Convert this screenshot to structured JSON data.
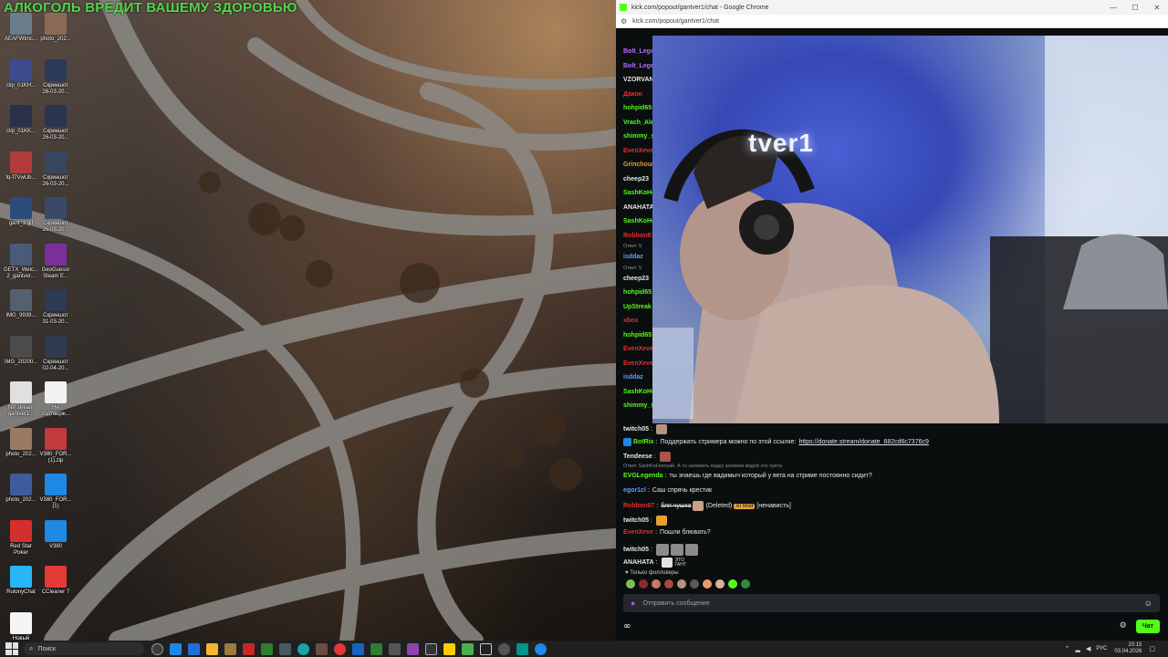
{
  "desktop": {
    "banner": "АЛКОГОЛЬ ВРЕДИТ ВАШЕМУ ЗДОРОВЬЮ",
    "icons": [
      {
        "label": "AEAFWtmc...",
        "color": "#6b7d8c"
      },
      {
        "label": "photo_202...",
        "color": "#8a6a55"
      },
      {
        "label": "clip_01KH...",
        "color": "#3e4b8e"
      },
      {
        "label": "Скриншот\n26-03-20...",
        "color": "#2c3a5a"
      },
      {
        "label": "clip_01KK...",
        "color": "#2b2f48"
      },
      {
        "label": "Скриншот\n26-03-20...",
        "color": "#2a3550"
      },
      {
        "label": "fq-f7VwUb...",
        "color": "#b23b3b"
      },
      {
        "label": "Скриншот\n26-03-20...",
        "color": "#384560"
      },
      {
        "label": "gant_3.gif",
        "color": "#2c4a7a"
      },
      {
        "label": "Скриншот\n26-03-20...",
        "color": "#3a4a66"
      },
      {
        "label": "GETX_Welc...\n2_gantver...",
        "color": "#4a5a78"
      },
      {
        "label": "GeoGuessr\nSteam E...",
        "color": "#7a2f9a"
      },
      {
        "label": "IMG_9939...",
        "color": "#55606e"
      },
      {
        "label": "Скриншот\n31-03-20...",
        "color": "#2f3b55"
      },
      {
        "label": "IMG_20200...",
        "color": "#4b4b4b"
      },
      {
        "label": "Скриншот\n02-04-20...",
        "color": "#303a50"
      },
      {
        "label": "NP stream\ngantver1...",
        "color": "#e0e0e0"
      },
      {
        "label": "Не\nподтверж...",
        "color": "#f2f2f2"
      },
      {
        "label": "photo_202...",
        "color": "#9a7a60"
      },
      {
        "label": "V380_FOR...\n(1).zip",
        "color": "#c23a3a"
      },
      {
        "label": "photo_202...",
        "color": "#3d5d9a"
      },
      {
        "label": "V380_FOR...\n(1)",
        "color": "#1e88e5"
      },
      {
        "label": "Red Star\nPoker",
        "color": "#d32f2f"
      },
      {
        "label": "V380",
        "color": "#1e88e5"
      },
      {
        "label": "RutonyChat",
        "color": "#29b6f6"
      },
      {
        "label": "CCleaner 7",
        "color": "#e53935"
      },
      {
        "label": "Новый\nтекстовый ...",
        "color": "#f5f5f5"
      }
    ]
  },
  "browser": {
    "title": "kick.com/popout/gantver1/chat - Google Chrome",
    "url": "kick.com/popout/gantver1/chat",
    "controls": {
      "minimize": "—",
      "maximize": "☐",
      "close": "✕"
    },
    "video_wall_text": "tver1"
  },
  "chat": {
    "side_users": [
      {
        "name": "Bolt_Lege",
        "color": "#b56cff"
      },
      {
        "name": "Bolt_Lege",
        "color": "#b56cff"
      },
      {
        "name": "VZORVAN",
        "color": "#e6e6e6"
      },
      {
        "name": "Дакон",
        "color": "#e03030"
      },
      {
        "name": "hohpid65",
        "color": "#53fc18"
      },
      {
        "name": "Vrach_Ale",
        "color": "#53fc18"
      },
      {
        "name": "shimmy_s",
        "color": "#53fc18"
      },
      {
        "name": "EvenXeve",
        "color": "#e03030"
      },
      {
        "name": "Grinchoun",
        "color": "#e0a030"
      },
      {
        "name": "cheep23",
        "color": "#e6e6e6"
      },
      {
        "name": "SashKoHo",
        "color": "#53fc18"
      },
      {
        "name": "ANAHATA",
        "color": "#e6e6e6"
      },
      {
        "name": "SashKoHo",
        "color": "#53fc18"
      },
      {
        "name": "Robbon87",
        "color": "#e03030"
      }
    ],
    "reply_header_1": "Ответ S",
    "reply_user_1": {
      "name": "isddaz",
      "color": "#5aa0ff",
      "text": "гр"
    },
    "reply_header_2": "Ответ S",
    "side_users_2": [
      {
        "name": "cheep23",
        "color": "#e6e6e6"
      },
      {
        "name": "hohpid65",
        "color": "#53fc18"
      },
      {
        "name": "UpStreak",
        "color": "#53fc18"
      },
      {
        "name": "xbox",
        "color": "#e03030"
      },
      {
        "name": "hohpid65",
        "color": "#53fc18"
      },
      {
        "name": "EvenXeve",
        "color": "#e03030"
      },
      {
        "name": "EvenXeve",
        "color": "#e03030"
      },
      {
        "name": "isddaz",
        "color": "#5aa0ff"
      },
      {
        "name": "SashKoHo",
        "color": "#53fc18"
      },
      {
        "name": "shimmy_s",
        "color": "#53fc18"
      }
    ],
    "messages": [
      {
        "user": "twitch05",
        "color": "#e6e6e6",
        "text": ""
      },
      {
        "user": "BotRix",
        "color": "#53fc18",
        "text": "Поддержать стримера можно по этой ссылке:",
        "link": "https://donate.stream/donate_682cd6c7376c9"
      },
      {
        "user": "Tendeese",
        "color": "#e6e6e6",
        "text": ""
      },
      {
        "user": "EVGLegenda",
        "color": "#53fc18",
        "text": "ты знаешь где вадимыч который у вега на стриме постоянно сидит?"
      },
      {
        "user": "egor1cl",
        "color": "#5aa0ff",
        "text": "Саш спрячь крестик"
      },
      {
        "user": "Robbon87",
        "color": "#e03030",
        "text": "бля чушка",
        "deleted": "(Deleted)",
        "tag": "AI Mod",
        "extra": "[ненависть]"
      },
      {
        "user": "twitch05",
        "color": "#e6e6e6",
        "text": ""
      },
      {
        "user": "EvenXeve",
        "color": "#e03030",
        "text": "Пошли блювать?"
      },
      {
        "user": "twitch05",
        "color": "#e6e6e6",
        "text": ""
      },
      {
        "user": "ANAHATA",
        "color": "#e6e6e6",
        "text": ""
      }
    ],
    "reply_header_3": "Ответ SashKoHomyak: А то заливать водку запивая водой это хуета",
    "followers_only": "Только фолловеры",
    "input_placeholder": "Отправить сообщение",
    "chat_button": "Чат",
    "anaхата_emote_text": "ЭТО\nГАНТ"
  },
  "taskbar": {
    "search_label": "Поиск",
    "lang": "РУС",
    "time": "20:15",
    "date": "03.04.2026"
  }
}
